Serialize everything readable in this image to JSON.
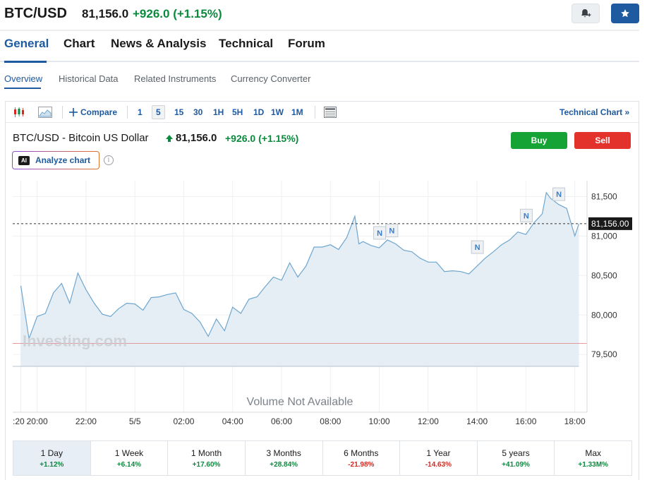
{
  "header": {
    "symbol": "BTC/USD",
    "price": "81,156.0",
    "change": "+926.0 (+1.15%)",
    "alert_icon": "bell-plus-icon",
    "watchlist_icon": "star-icon"
  },
  "tabs": [
    {
      "label": "General",
      "active": true
    },
    {
      "label": "Chart"
    },
    {
      "label": "News & Analysis"
    },
    {
      "label": "Technical"
    },
    {
      "label": "Forum"
    }
  ],
  "subtabs": [
    {
      "label": "Overview",
      "active": true
    },
    {
      "label": "Historical Data"
    },
    {
      "label": "Related Instruments"
    },
    {
      "label": "Currency Converter"
    }
  ],
  "toolbar": {
    "compare_label": "Compare",
    "intervals": [
      "1",
      "5",
      "15",
      "30",
      "1H",
      "5H",
      "1D",
      "1W",
      "1M"
    ],
    "selected_interval": "5",
    "technical_chart_label": "Technical Chart »"
  },
  "chart_header": {
    "title": "BTC/USD - Bitcoin US Dollar",
    "price": "81,156.0",
    "change": "+926.0",
    "change_pct": "(+1.15%)",
    "buy_label": "Buy",
    "sell_label": "Sell",
    "analyze_label": "Analyze chart",
    "ai_badge": "AI",
    "info_icon": "i"
  },
  "chart_data": {
    "type": "area",
    "series": [
      {
        "x": [
          "19:20",
          "19:40",
          "20:00",
          "20:20",
          "20:40",
          "21:00",
          "21:20",
          "21:40",
          "22:00",
          "22:20",
          "22:40",
          "23:00",
          "23:20",
          "23:40",
          "00:00",
          "00:20",
          "00:40",
          "01:00",
          "01:20",
          "01:40",
          "02:00",
          "02:20",
          "02:40",
          "03:00",
          "03:20",
          "03:40",
          "04:00",
          "04:20",
          "04:40",
          "05:00",
          "05:20",
          "05:40",
          "06:00",
          "06:20",
          "06:40",
          "07:00",
          "07:20",
          "07:40",
          "08:00",
          "08:20",
          "08:40",
          "09:00",
          "09:10",
          "09:20",
          "09:40",
          "10:00",
          "10:20",
          "10:40",
          "11:00",
          "11:20",
          "11:40",
          "12:00",
          "12:20",
          "12:40",
          "13:00",
          "13:20",
          "13:40",
          "14:00",
          "14:20",
          "14:40",
          "15:00",
          "15:20",
          "15:40",
          "16:00",
          "16:20",
          "16:40",
          "16:50",
          "17:00",
          "17:20",
          "17:40",
          "18:00",
          "18:10"
        ],
        "values": [
          80370,
          79700,
          79980,
          80020,
          80280,
          80400,
          80150,
          80530,
          80320,
          80150,
          80010,
          79980,
          80080,
          80150,
          80140,
          80060,
          80220,
          80230,
          80260,
          80280,
          80070,
          80020,
          79910,
          79730,
          79950,
          79800,
          80100,
          80020,
          80200,
          80230,
          80360,
          80480,
          80440,
          80660,
          80480,
          80620,
          80860,
          80860,
          80890,
          80830,
          80980,
          81250,
          80900,
          80930,
          80880,
          80850,
          80950,
          80900,
          80820,
          80800,
          80720,
          80670,
          80670,
          80550,
          80560,
          80550,
          80520,
          80620,
          80720,
          80800,
          80890,
          80950,
          81050,
          81020,
          81170,
          81280,
          81550,
          81480,
          81400,
          81350,
          81000,
          81156
        ]
      }
    ],
    "y_ticks": [
      81500,
      81000,
      80500,
      80000,
      79500
    ],
    "ylim": [
      79350,
      81700
    ],
    "x_tick_labels": [
      ":20",
      "20:00",
      "22:00",
      "5/5",
      "02:00",
      "04:00",
      "06:00",
      "08:00",
      "10:00",
      "12:00",
      "14:00",
      "16:00",
      "18:00"
    ],
    "x_tick_times": [
      "19:20",
      "20:00",
      "22:00",
      "00:00",
      "02:00",
      "04:00",
      "06:00",
      "08:00",
      "10:00",
      "12:00",
      "14:00",
      "16:00",
      "18:00"
    ],
    "last_price_label": "81,156.00",
    "last_price": 81156,
    "reference_line": 79640,
    "news_markers": [
      {
        "label": "N",
        "time": "10:00",
        "value": 80950
      },
      {
        "label": "N",
        "time": "10:30",
        "value": 80980
      },
      {
        "label": "N",
        "time": "14:00",
        "value": 80770
      },
      {
        "label": "N",
        "time": "16:00",
        "value": 81170
      },
      {
        "label": "N",
        "time": "17:20",
        "value": 81440
      }
    ],
    "volume_label": "Volume Not Available",
    "watermark": "Investing.com",
    "grid": true,
    "colors": {
      "line": "#6ea6cf",
      "fill": "#e6eef5",
      "reference": "#e39a9a"
    }
  },
  "periods": [
    {
      "label": "1 Day",
      "value": "+1.12%",
      "active": true
    },
    {
      "label": "1 Week",
      "value": "+6.14%"
    },
    {
      "label": "1 Month",
      "value": "+17.60%"
    },
    {
      "label": "3 Months",
      "value": "+28.84%"
    },
    {
      "label": "6 Months",
      "value": "-21.98%"
    },
    {
      "label": "1 Year",
      "value": "-14.63%"
    },
    {
      "label": "5 years",
      "value": "+41.09%"
    },
    {
      "label": "Max",
      "value": "+1.33M%"
    }
  ]
}
